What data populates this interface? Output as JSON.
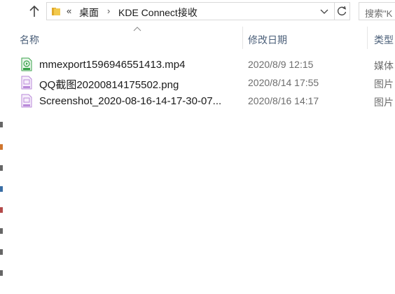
{
  "address_bar": {
    "overflow_glyph": "«",
    "breadcrumbs": [
      "桌面",
      "KDE Connect接收"
    ],
    "separator_glyph": "›"
  },
  "search": {
    "text": "搜索\"K"
  },
  "columns": {
    "name": "名称",
    "date_modified": "修改日期",
    "type": "类型"
  },
  "files": [
    {
      "name": "mmexport1596946551413.mp4",
      "date": "2020/8/9 12:15",
      "type": "媒体",
      "icon": "video-file-icon"
    },
    {
      "name": "QQ截图20200814175502.png",
      "date": "2020/8/14 17:55",
      "type": "图片",
      "icon": "image-file-icon"
    },
    {
      "name": "Screenshot_2020-08-16-14-17-30-07...",
      "date": "2020/8/16 14:17",
      "type": "图片",
      "icon": "image-file-icon"
    }
  ],
  "colors": {
    "header_text": "#4c607a",
    "video_icon": "#3aa34b",
    "image_icon": "#b98ad9",
    "folder": "#f2c94c"
  }
}
